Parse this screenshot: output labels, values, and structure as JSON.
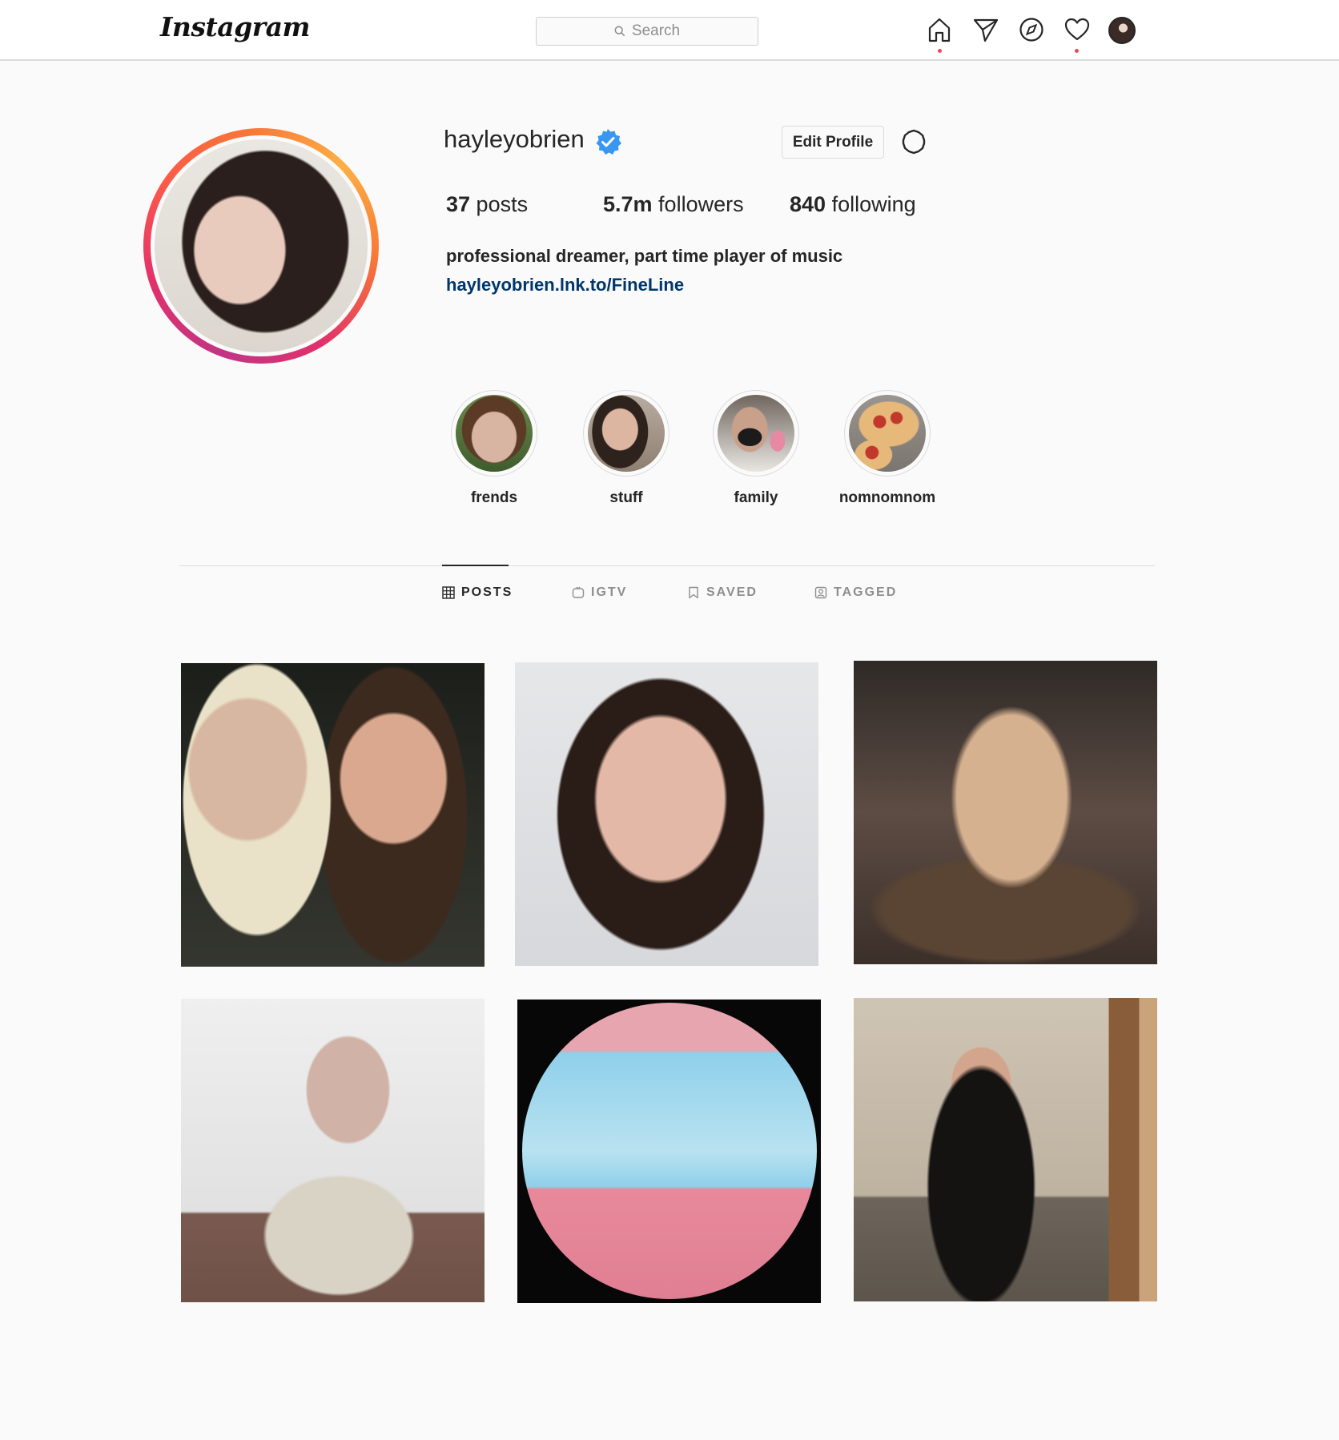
{
  "topbar": {
    "logo": "Instagram",
    "search_placeholder": "Search",
    "icons": [
      "home-icon",
      "direct-icon",
      "explore-icon",
      "activity-icon",
      "profile-avatar"
    ],
    "notification_dot_color": "#ed4956"
  },
  "profile": {
    "username": "hayleyobrien",
    "verified": true,
    "edit_button": "Edit Profile",
    "stats": {
      "posts_count": "37",
      "posts_label": " posts",
      "followers_count": "5.7m",
      "followers_label": " followers",
      "following_count": "840",
      "following_label": " following"
    },
    "bio": "professional dreamer, part time player of music",
    "link": "hayleyobrien.lnk.to/FineLine",
    "link_color": "#00376b"
  },
  "highlights": [
    {
      "label": "frends"
    },
    {
      "label": "stuff"
    },
    {
      "label": "family"
    },
    {
      "label": "nomnomnom"
    }
  ],
  "tabs": [
    {
      "label": "POSTS",
      "icon": "grid-icon",
      "active": true
    },
    {
      "label": "IGTV",
      "icon": "igtv-icon",
      "active": false
    },
    {
      "label": "SAVED",
      "icon": "bookmark-icon",
      "active": false
    },
    {
      "label": "TAGGED",
      "icon": "tagged-icon",
      "active": false
    }
  ],
  "colors": {
    "background": "#fafafa",
    "border": "#dbdbdb",
    "verified_blue": "#3897f0",
    "text": "#262626",
    "muted": "#8e8e8e"
  }
}
